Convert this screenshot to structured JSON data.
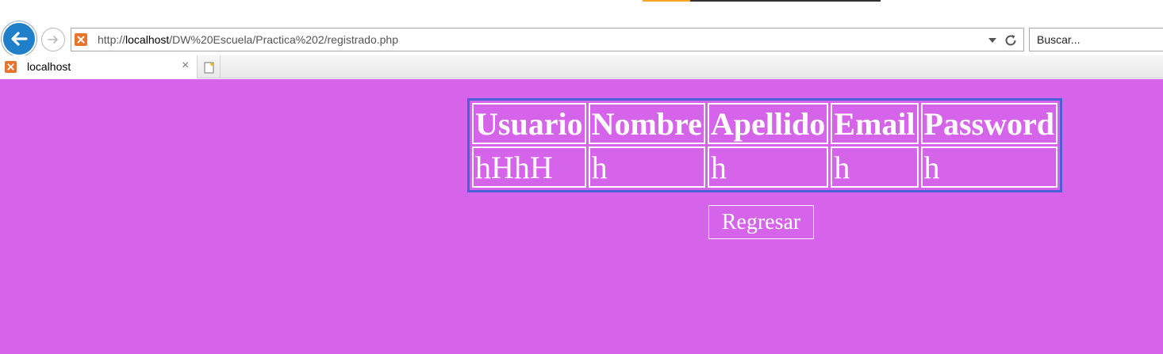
{
  "browser": {
    "address_url_prefix": "http://",
    "address_url_host": "localhost",
    "address_url_path": "/DW%20Escuela/Practica%202/registrado.php",
    "search_placeholder": "Buscar...",
    "tab_title": "localhost",
    "tab_close_glyph": "×",
    "icons": [
      "back-arrow-icon",
      "forward-arrow-icon",
      "xampp-favicon-icon",
      "dropdown-icon",
      "refresh-icon",
      "close-icon",
      "new-tab-icon"
    ]
  },
  "page": {
    "background_color": "#d664ea",
    "table_border_color": "#4a61d6",
    "table": {
      "headers": [
        "Usuario",
        "Nombre",
        "Apellido",
        "Email",
        "Password"
      ],
      "rows": [
        [
          "hHhH",
          "h",
          "h",
          "h",
          "h"
        ]
      ]
    },
    "back_button_label": "Regresar"
  }
}
